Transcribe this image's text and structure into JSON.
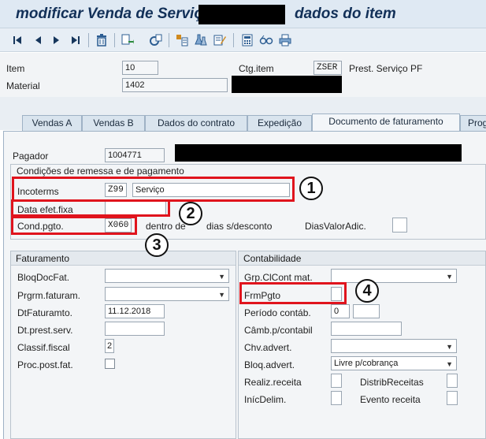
{
  "title": {
    "part1": "modificar Venda de Serviço",
    "part2": "dados do item"
  },
  "header": {
    "item_label": "Item",
    "item_value": "10",
    "ctg_label": "Ctg.item",
    "ctg_value": "ZSER",
    "ctg_desc": "Prest. Serviço PF",
    "material_label": "Material",
    "material_value": "1402"
  },
  "tabs": [
    {
      "label": "Vendas A"
    },
    {
      "label": "Vendas B"
    },
    {
      "label": "Dados do contrato"
    },
    {
      "label": "Expedição"
    },
    {
      "label": "Documento de faturamento"
    },
    {
      "label": "Prog"
    }
  ],
  "payer": {
    "label": "Pagador",
    "value": "1004771"
  },
  "conditions": {
    "title": "Condições de remessa e de pagamento",
    "incoterms_label": "Incoterms",
    "incoterms_code": "Z99",
    "incoterms_desc": "Serviço",
    "data_efet_label": "Data efet.fixa",
    "data_efet_value": "",
    "cond_label": "Cond.pgto.",
    "cond_value": "X060",
    "within_text": "dentro de",
    "days_text": "dias s/desconto",
    "dias_valor_label": "DiasValorAdic."
  },
  "billing": {
    "title": "Faturamento",
    "bloq_label": "BloqDocFat.",
    "bloq_value": "",
    "prgrm_label": "Prgrm.faturam.",
    "prgrm_value": "",
    "dt_fat_label": "DtFaturamto.",
    "dt_fat_value": "11.12.2018",
    "dt_prest_label": "Dt.prest.serv.",
    "dt_prest_value": "",
    "classif_label": "Classif.fiscal",
    "classif_value": "2",
    "proc_label": "Proc.post.fat."
  },
  "accounting": {
    "title": "Contabilidade",
    "grp_label": "Grp.ClCont mat.",
    "grp_value": "",
    "frm_label": "FrmPgto",
    "frm_value": "",
    "periodo_label": "Período contáb.",
    "periodo_value": "0",
    "camb_label": "Câmb.p/contabil",
    "camb_value": "",
    "chv_label": "Chv.advert.",
    "chv_value": "",
    "bloq_adv_label": "Bloq.advert.",
    "bloq_adv_value": "Livre p/cobrança",
    "realiz_label": "Realiz.receita",
    "distrib_label": "DistribReceitas",
    "inic_label": "InícDelim.",
    "evento_label": "Evento receita"
  },
  "annotations": {
    "n1": "1",
    "n2": "2",
    "n3": "3",
    "n4": "4"
  },
  "colors": {
    "highlight": "#e0141d",
    "title_text": "#123058"
  }
}
